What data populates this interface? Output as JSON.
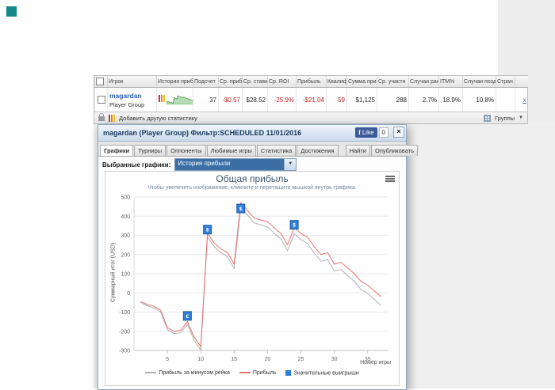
{
  "page": {
    "logo_color": "#138a8a"
  },
  "stats_table": {
    "headers": [
      "",
      "Игрок",
      "История приб",
      "Подсчет",
      "Ср. приб",
      "Ср. ставк",
      "Ср. ROI",
      "Прибыль",
      "Квалиф",
      "Сумма приз",
      "Ср. участн",
      "Случаи ран",
      "ITM%",
      "Случаи позд",
      "Стран",
      ""
    ],
    "row": {
      "player": "magardan",
      "group": "Player Group",
      "count": "37",
      "avg_profit": "-$0.57",
      "avg_stake": "$28.52",
      "avg_roi": "-25.9%",
      "profit": "-$21.04",
      "qualified": "59",
      "prize_total": "$1,125",
      "avg_entrants": "288",
      "early_cases": "2.7%",
      "itm_pct": "18.9%",
      "late_cases": "10.8%",
      "remove_link": "x"
    },
    "footer": {
      "add_statistic_label": "Добавить другую статистику",
      "groups_label": "Группы"
    }
  },
  "modal": {
    "title": "magardan (Player Group) Фильтр:SCHEDULED 11/01/2016",
    "like_label": "Like",
    "like_f": "f",
    "like_count": "0",
    "close_label": "×",
    "tabs": [
      {
        "label": "Графики"
      },
      {
        "label": "Турниры"
      },
      {
        "label": "Оппоненты"
      },
      {
        "label": "Любимые игры"
      },
      {
        "label": "Статистика"
      },
      {
        "label": "Достижения"
      },
      {
        "label": "Найти"
      },
      {
        "label": "Опубликовать"
      }
    ],
    "selector_label": "Выбранные графики:",
    "selector_value": "История прибыли"
  },
  "chart_data": {
    "type": "line",
    "title": "Общая прибыль",
    "subtitle": "Чтобы увеличить изображение, кликните и перетащите мышкой внутрь графика.",
    "ylabel": "Суммарный итог (USD)",
    "xlabel": "Номер игры",
    "ylim": [
      -300,
      500
    ],
    "yticks": [
      -300,
      -200,
      -100,
      0,
      100,
      200,
      300,
      400,
      500
    ],
    "xticks": [
      5,
      10,
      15,
      20,
      25,
      30,
      35
    ],
    "grid": true,
    "legend_position": "bottom",
    "series": [
      {
        "name": "Прибыль за минусом рейка",
        "color": "#b0b0b0",
        "values": [
          -50,
          -67,
          -78,
          -99,
          -191,
          -212,
          -208,
          -164,
          -246,
          -297,
          292,
          241,
          210,
          189,
          128,
          447,
          406,
          365,
          354,
          343,
          312,
          281,
          220,
          309,
          278,
          257,
          206,
          165,
          174,
          113,
          122,
          90,
          59,
          18,
          -3,
          -34,
          -66
        ]
      },
      {
        "name": "Прибыль",
        "color": "#e8716f",
        "values": [
          -45,
          -60,
          -70,
          -90,
          -180,
          -200,
          -195,
          -150,
          -230,
          -280,
          310,
          260,
          230,
          210,
          150,
          470,
          430,
          390,
          380,
          370,
          340,
          310,
          250,
          340,
          310,
          290,
          240,
          200,
          210,
          150,
          160,
          130,
          100,
          60,
          40,
          10,
          -21
        ]
      }
    ],
    "markers": {
      "name": "Значительные выигрыши",
      "color": "#2f7ed8",
      "points": [
        {
          "game": 8,
          "value": -120,
          "symbol": "€"
        },
        {
          "game": 11,
          "value": 330,
          "symbol": "$"
        },
        {
          "game": 16,
          "value": 440,
          "symbol": "$"
        },
        {
          "game": 24,
          "value": 355,
          "symbol": "$"
        }
      ]
    }
  }
}
